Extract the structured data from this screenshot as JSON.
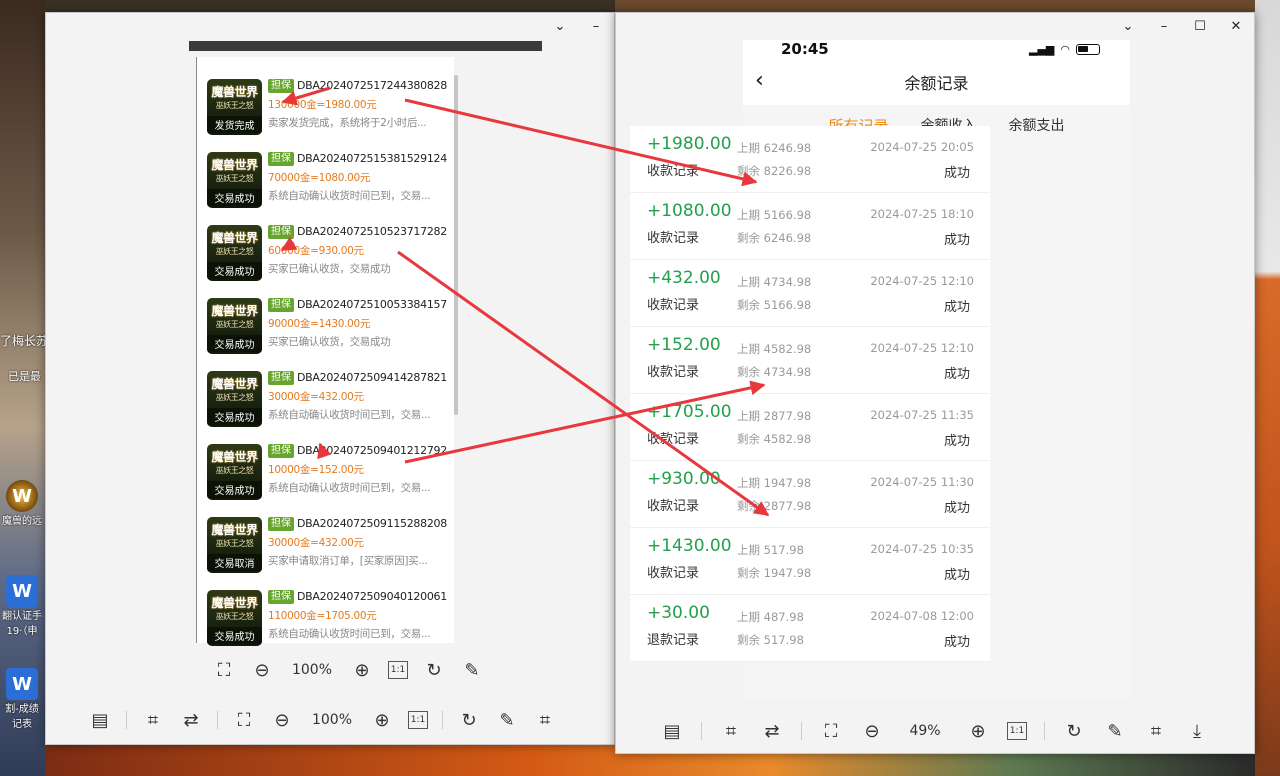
{
  "desktop": {
    "icons": [
      {
        "name": "wow-icon",
        "label": "魔兽的远征"
      },
      {
        "name": "wps-doc-icon-1",
        "label": "翻认证手"
      },
      {
        "name": "wps-doc-icon-2",
        "label": "割-成绩"
      }
    ],
    "side_texts": [
      "了梅长苏",
      "已是最",
      "19·（申",
      "记表"
    ]
  },
  "left_window": {
    "orders": [
      {
        "game": "魔兽世界",
        "sub": "巫妖王之怒",
        "status": "发货完成",
        "tag": "担保",
        "order_no": "DBA2024072517244380828",
        "amount": "130000金=1980.00元",
        "desc": "卖家发货完成，系统将于2小时后..."
      },
      {
        "game": "魔兽世界",
        "sub": "巫妖王之怒",
        "status": "交易成功",
        "tag": "担保",
        "order_no": "DBA2024072515381529124",
        "amount": "70000金=1080.00元",
        "desc": "系统自动确认收货时间已到，交易..."
      },
      {
        "game": "魔兽世界",
        "sub": "巫妖王之怒",
        "status": "交易成功",
        "tag": "担保",
        "order_no": "DBA2024072510523717282",
        "amount": "60000金=930.00元",
        "desc": "买家已确认收货，交易成功"
      },
      {
        "game": "魔兽世界",
        "sub": "巫妖王之怒",
        "status": "交易成功",
        "tag": "担保",
        "order_no": "DBA2024072510053384157",
        "amount": "90000金=1430.00元",
        "desc": "买家已确认收货，交易成功"
      },
      {
        "game": "魔兽世界",
        "sub": "巫妖王之怒",
        "status": "交易成功",
        "tag": "担保",
        "order_no": "DBA2024072509414287821",
        "amount": "30000金=432.00元",
        "desc": "系统自动确认收货时间已到，交易..."
      },
      {
        "game": "魔兽世界",
        "sub": "巫妖王之怒",
        "status": "交易成功",
        "tag": "担保",
        "order_no": "DBA2024072509401212792",
        "amount": "10000金=152.00元",
        "desc": "系统自动确认收货时间已到，交易..."
      },
      {
        "game": "魔兽世界",
        "sub": "巫妖王之怒",
        "status": "交易取消",
        "tag": "担保",
        "order_no": "DBA2024072509115288208",
        "amount": "30000金=432.00元",
        "desc": "买家申请取消订单，[买家原因]买..."
      },
      {
        "game": "魔兽世界",
        "sub": "巫妖王之怒",
        "status": "交易成功",
        "tag": "担保",
        "order_no": "DBA2024072509040120061",
        "amount": "110000金=1705.00元",
        "desc": "系统自动确认收货时间已到，交易..."
      }
    ],
    "inner_zoom": "100%",
    "outer_zoom": "100%",
    "one_to_one": "1:1"
  },
  "right_window": {
    "status_time": "20:45",
    "title": "余额记录",
    "tabs": [
      "所有记录",
      "余额收入",
      "余额支出"
    ],
    "records": [
      {
        "amount": "+1980.00",
        "type": "收款记录",
        "prev": "上期 6246.98",
        "remain": "剩余 8226.98",
        "date": "2024-07-25 20:05",
        "status": "成功"
      },
      {
        "amount": "+1080.00",
        "type": "收款记录",
        "prev": "上期 5166.98",
        "remain": "剩余 6246.98",
        "date": "2024-07-25 18:10",
        "status": "成功"
      },
      {
        "amount": "+432.00",
        "type": "收款记录",
        "prev": "上期 4734.98",
        "remain": "剩余 5166.98",
        "date": "2024-07-25 12:10",
        "status": "成功"
      },
      {
        "amount": "+152.00",
        "type": "收款记录",
        "prev": "上期 4582.98",
        "remain": "剩余 4734.98",
        "date": "2024-07-25 12:10",
        "status": "成功"
      },
      {
        "amount": "+1705.00",
        "type": "收款记录",
        "prev": "上期 2877.98",
        "remain": "剩余 4582.98",
        "date": "2024-07-25 11:35",
        "status": "成功"
      },
      {
        "amount": "+930.00",
        "type": "收款记录",
        "prev": "上期 1947.98",
        "remain": "剩余 2877.98",
        "date": "2024-07-25 11:30",
        "status": "成功"
      },
      {
        "amount": "+1430.00",
        "type": "收款记录",
        "prev": "上期 517.98",
        "remain": "剩余 1947.98",
        "date": "2024-07-25 10:35",
        "status": "成功"
      },
      {
        "amount": "+30.00",
        "type": "退款记录",
        "prev": "上期 487.98",
        "remain": "剩余 517.98",
        "date": "2024-07-08 12:00",
        "status": "成功"
      }
    ],
    "zoom": "49%",
    "one_to_one": "1:1"
  },
  "colors": {
    "accent_orange": "#f08a1c",
    "amount_green": "#22a04b",
    "arrow_red": "#e8383d",
    "tag_green": "#67a52e"
  }
}
